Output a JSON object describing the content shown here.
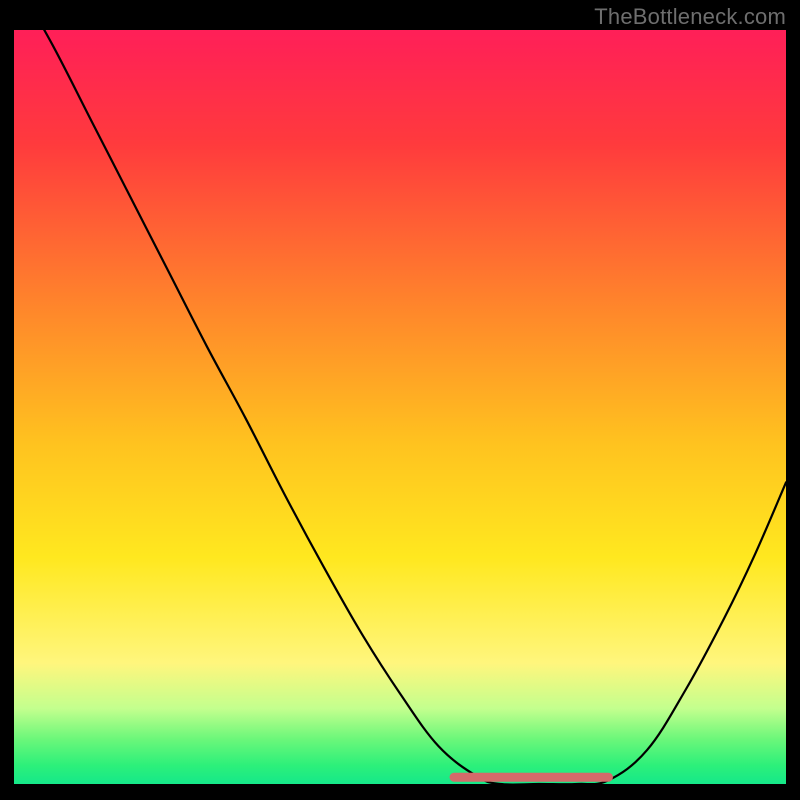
{
  "watermark": "TheBottleneck.com",
  "colors": {
    "pink": "#ff1f58",
    "red": "#ff3a3d",
    "orange": "#ff8a2a",
    "yellowDark": "#ffc31f",
    "yellow": "#ffe81f",
    "yellowPale": "#fff67d",
    "greenPale": "#c3ff8e",
    "greenMid": "#6cf77a",
    "green": "#2df07a",
    "greenDeep": "#15e889",
    "curve": "#000000",
    "flatStroke": "#d46a6a",
    "background": "#000000"
  },
  "chart_data": {
    "type": "line",
    "title": "",
    "xlabel": "",
    "ylabel": "",
    "xlim": [
      0,
      100
    ],
    "ylim": [
      0,
      100
    ],
    "series": [
      {
        "name": "bottleneck-curve",
        "x": [
          0,
          5,
          10,
          15,
          20,
          25,
          30,
          35,
          40,
          45,
          50,
          55,
          60,
          63,
          68,
          73,
          77,
          82,
          87,
          92,
          96,
          100
        ],
        "values": [
          107,
          98,
          88,
          78,
          68,
          58,
          48.5,
          38.5,
          29,
          20,
          12,
          5,
          1,
          0,
          0,
          0,
          0.5,
          4.5,
          12.5,
          22.0,
          30.5,
          40
        ]
      },
      {
        "name": "optimal-flat",
        "x": [
          57,
          77
        ],
        "values": [
          0.9,
          0.9
        ]
      }
    ],
    "gradient_stops": [
      {
        "pos": 0.0,
        "colorKey": "pink"
      },
      {
        "pos": 0.15,
        "colorKey": "red"
      },
      {
        "pos": 0.38,
        "colorKey": "orange"
      },
      {
        "pos": 0.55,
        "colorKey": "yellowDark"
      },
      {
        "pos": 0.7,
        "colorKey": "yellow"
      },
      {
        "pos": 0.84,
        "colorKey": "yellowPale"
      },
      {
        "pos": 0.9,
        "colorKey": "greenPale"
      },
      {
        "pos": 0.94,
        "colorKey": "greenMid"
      },
      {
        "pos": 0.975,
        "colorKey": "green"
      },
      {
        "pos": 1.0,
        "colorKey": "greenDeep"
      }
    ]
  }
}
